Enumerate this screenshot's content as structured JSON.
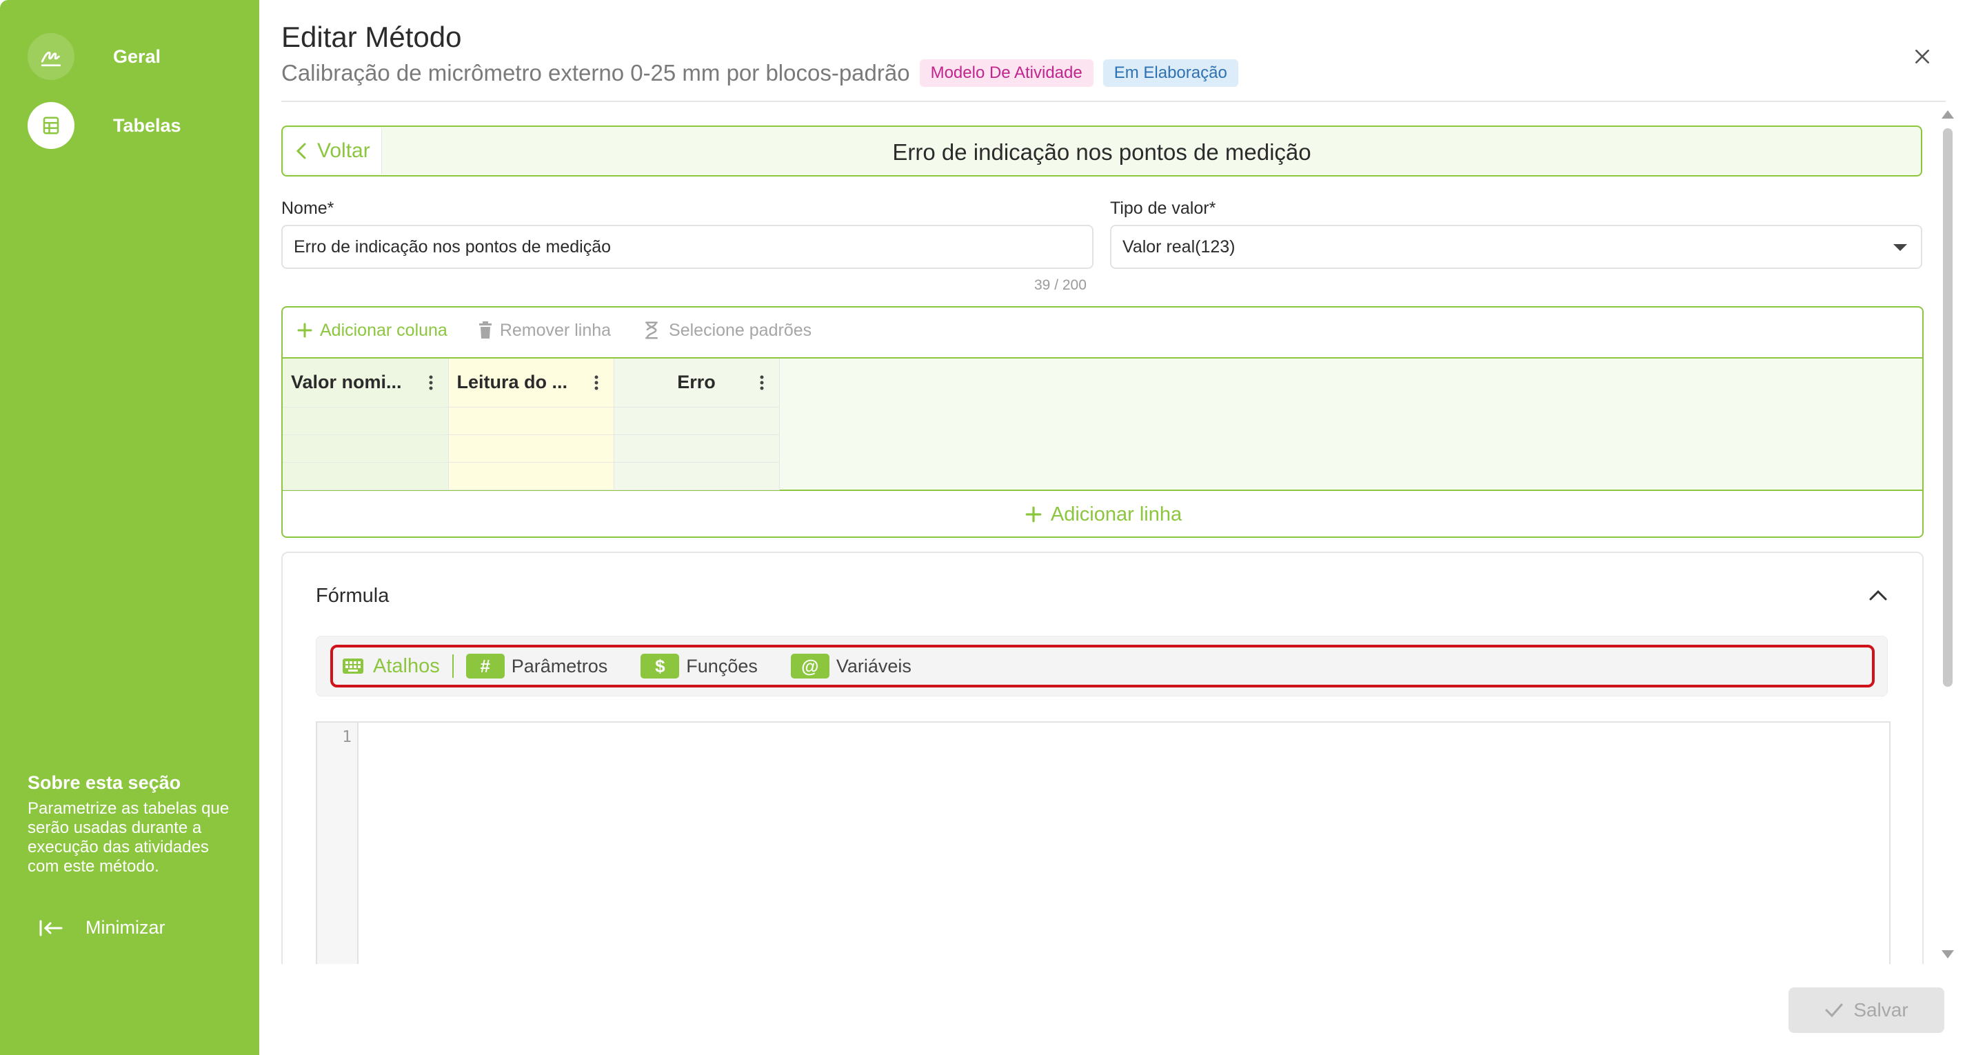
{
  "sidebar": {
    "items": [
      {
        "label": "Geral",
        "icon": "signature-icon",
        "active": false
      },
      {
        "label": "Tabelas",
        "icon": "table-icon",
        "active": true
      }
    ],
    "about_title": "Sobre esta seção",
    "about_text": "Parametrize as tabelas que serão usadas durante a execução das atividades com este método.",
    "minimize_label": "Minimizar"
  },
  "header": {
    "title": "Editar Método",
    "subtitle": "Calibração de micrômetro externo 0-25 mm por blocos-padrão",
    "badges": [
      {
        "label": "Modelo De Atividade",
        "color": "#c2258d"
      },
      {
        "label": "Em Elaboração",
        "color": "#2f72b4"
      }
    ]
  },
  "back_bar": {
    "back_label": "Voltar",
    "title": "Erro de indicação nos pontos de medição"
  },
  "form": {
    "name_label": "Nome*",
    "name_value": "Erro de indicação nos pontos de medição",
    "name_counter": "39 / 200",
    "type_label": "Tipo de valor*",
    "type_value": "Valor real(123)"
  },
  "table_editor": {
    "toolbar": {
      "add_column": "Adicionar coluna",
      "remove_row": "Remover linha",
      "select_standards": "Selecione padrões"
    },
    "columns": [
      "Valor nomi...",
      "Leitura do ...",
      "Erro"
    ],
    "row_count": 3,
    "add_row": "Adicionar linha"
  },
  "formula": {
    "title": "Fórmula",
    "shortcuts_label": "Atalhos",
    "chips": [
      {
        "symbol": "#",
        "label": "Parâmetros"
      },
      {
        "symbol": "$",
        "label": "Funções"
      },
      {
        "symbol": "@",
        "label": "Variáveis"
      }
    ],
    "line_number": "1"
  },
  "footer": {
    "save_label": "Salvar"
  },
  "colors": {
    "brand": "#8cc63f",
    "highlight": "#d0131b"
  }
}
